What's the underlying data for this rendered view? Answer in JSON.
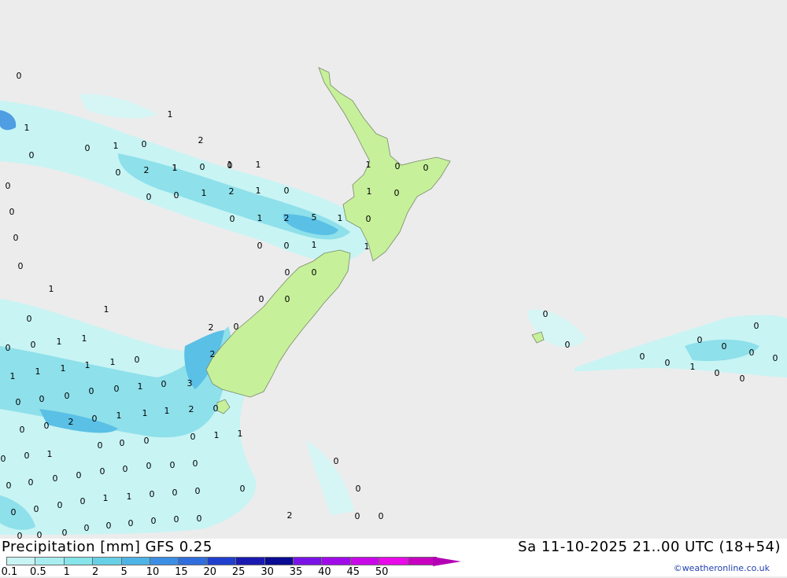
{
  "header": {
    "title": "Precipitation [mm] GFS 0.25",
    "datetime": "Sa 11-10-2025 21..00 UTC (18+54)",
    "credit": "©weatheronline.co.uk"
  },
  "legend": {
    "ticks": [
      "0.1",
      "0.5",
      "1",
      "2",
      "5",
      "10",
      "15",
      "20",
      "25",
      "30",
      "35",
      "40",
      "45",
      "50"
    ],
    "colors": [
      "#c8f4f4",
      "#a8eef0",
      "#86e4ea",
      "#66d0e6",
      "#4eb4e6",
      "#3c8ee4",
      "#2f6edc",
      "#1f3fcc",
      "#1a1ab0",
      "#0a0a92",
      "#7a14e6",
      "#a00ce8",
      "#c80ae8",
      "#e80ae8",
      "#c800c0"
    ],
    "end_color": "#b400b4"
  },
  "map": {
    "ocean_color": "#ececec",
    "land_color": "#c6f09a",
    "labels": [
      {
        "t": "0"
      },
      {
        "t": "1"
      },
      {
        "t": "0"
      },
      {
        "t": "0"
      },
      {
        "t": "1"
      },
      {
        "t": "0"
      },
      {
        "t": "0"
      },
      {
        "t": "1"
      },
      {
        "t": "0"
      },
      {
        "t": "2"
      },
      {
        "t": "1"
      },
      {
        "t": "0"
      },
      {
        "t": "0"
      },
      {
        "t": "1"
      },
      {
        "t": "0"
      },
      {
        "t": "0"
      },
      {
        "t": "1"
      },
      {
        "t": "2"
      },
      {
        "t": "1"
      },
      {
        "t": "0"
      },
      {
        "t": "0"
      },
      {
        "t": "1"
      },
      {
        "t": "2"
      },
      {
        "t": "5"
      },
      {
        "t": "1"
      },
      {
        "t": "0"
      },
      {
        "t": "0"
      },
      {
        "t": "0"
      },
      {
        "t": "1"
      },
      {
        "t": "1"
      },
      {
        "t": "0"
      },
      {
        "t": "0"
      },
      {
        "t": "0"
      },
      {
        "t": "0"
      },
      {
        "t": "0"
      },
      {
        "t": "0"
      },
      {
        "t": "0"
      },
      {
        "t": "1"
      },
      {
        "t": "1"
      },
      {
        "t": "0"
      },
      {
        "t": "0"
      },
      {
        "t": "0"
      },
      {
        "t": "1"
      },
      {
        "t": "1"
      },
      {
        "t": "0"
      },
      {
        "t": "0"
      },
      {
        "t": "1"
      },
      {
        "t": "1"
      },
      {
        "t": "1"
      },
      {
        "t": "0"
      },
      {
        "t": "0"
      },
      {
        "t": "2"
      },
      {
        "t": "0"
      },
      {
        "t": "1"
      },
      {
        "t": "1"
      },
      {
        "t": "1"
      },
      {
        "t": "1"
      },
      {
        "t": "3"
      },
      {
        "t": "0"
      },
      {
        "t": "0"
      },
      {
        "t": "0"
      },
      {
        "t": "0"
      },
      {
        "t": "0"
      },
      {
        "t": "2"
      },
      {
        "t": "1"
      },
      {
        "t": "0"
      },
      {
        "t": "0"
      },
      {
        "t": "0"
      },
      {
        "t": "2"
      },
      {
        "t": "0"
      },
      {
        "t": "1"
      },
      {
        "t": "2"
      },
      {
        "t": "0"
      },
      {
        "t": "1"
      },
      {
        "t": "1"
      },
      {
        "t": "1"
      },
      {
        "t": "0"
      },
      {
        "t": "0"
      },
      {
        "t": "0"
      },
      {
        "t": "0"
      },
      {
        "t": "0"
      },
      {
        "t": "1"
      },
      {
        "t": "1"
      },
      {
        "t": "0"
      },
      {
        "t": "0"
      },
      {
        "t": "0"
      },
      {
        "t": "0"
      },
      {
        "t": "0"
      },
      {
        "t": "0"
      },
      {
        "t": "0"
      },
      {
        "t": "0"
      },
      {
        "t": "0"
      },
      {
        "t": "0"
      },
      {
        "t": "0"
      },
      {
        "t": "0"
      },
      {
        "t": "1"
      },
      {
        "t": "1"
      },
      {
        "t": "0"
      },
      {
        "t": "0"
      },
      {
        "t": "0"
      },
      {
        "t": "0"
      },
      {
        "t": "0"
      },
      {
        "t": "0"
      },
      {
        "t": "0"
      },
      {
        "t": "0"
      },
      {
        "t": "0"
      },
      {
        "t": "0"
      },
      {
        "t": "0"
      },
      {
        "t": "0"
      },
      {
        "t": "2"
      },
      {
        "t": "0"
      },
      {
        "t": "0"
      },
      {
        "t": "0"
      },
      {
        "t": "0"
      },
      {
        "t": "0"
      },
      {
        "t": "0"
      },
      {
        "t": "0"
      },
      {
        "t": "0"
      },
      {
        "t": "0"
      },
      {
        "t": "0"
      },
      {
        "t": "0"
      },
      {
        "t": "0"
      },
      {
        "t": "0"
      },
      {
        "t": "0"
      },
      {
        "t": "1"
      },
      {
        "t": "0"
      },
      {
        "t": "0"
      },
      {
        "t": "0"
      },
      {
        "t": "0"
      },
      {
        "t": "2"
      },
      {
        "t": "1"
      },
      {
        "t": "1"
      },
      {
        "t": "0"
      },
      {
        "t": "0"
      },
      {
        "t": "0"
      }
    ]
  }
}
